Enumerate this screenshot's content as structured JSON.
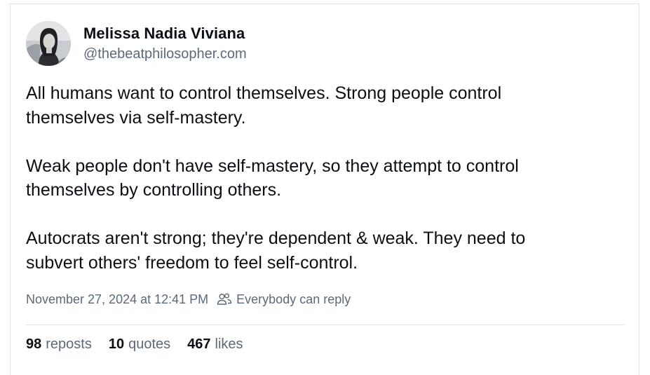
{
  "author": {
    "display_name": "Melissa Nadia Viviana",
    "handle": "@thebeatphilosopher.com",
    "avatar_icon": "avatar-photo"
  },
  "post": {
    "paragraphs": [
      "All humans want to control themselves. Strong people control\nthemselves via self-mastery.",
      "Weak people don't have self-mastery, so they attempt to control\nthemselves by controlling others.",
      "Autocrats aren't strong; they're dependent & weak. They need to\nsubvert others' freedom to feel self-control."
    ],
    "timestamp": "November 27, 2024 at 12:41 PM",
    "reply_setting": "Everybody can reply",
    "reply_setting_icon": "people-icon"
  },
  "stats": {
    "reposts_count": "98",
    "reposts_label": "reposts",
    "quotes_count": "10",
    "quotes_label": "quotes",
    "likes_count": "467",
    "likes_label": "likes"
  },
  "colors": {
    "text_primary": "#0b0f14",
    "text_secondary": "#5b6978",
    "border": "#dfe3e8",
    "background": "#ffffff"
  }
}
